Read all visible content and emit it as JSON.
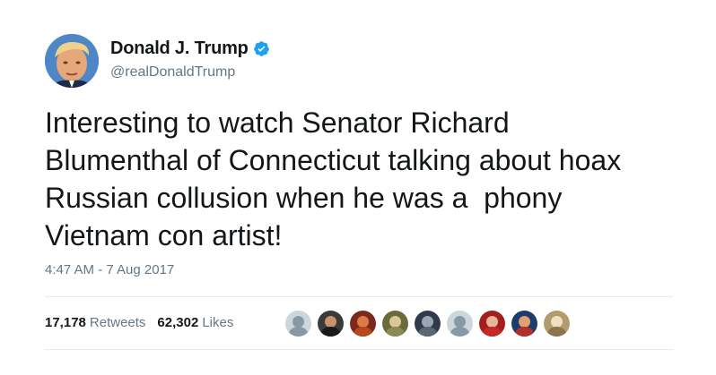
{
  "user": {
    "display_name": "Donald J. Trump",
    "handle": "@realDonaldTrump",
    "verified": true,
    "avatar_icon": "profile-photo"
  },
  "tweet": {
    "text": "Interesting to watch Senator Richard\nBlumenthal of Connecticut talking about hoax\nRussian collusion when he was a  phony\nVietnam con artist!",
    "timestamp": "4:47 AM - 7 Aug 2017"
  },
  "stats": {
    "retweets_count": "17,178",
    "retweets_label": "Retweets",
    "likes_count": "62,302",
    "likes_label": "Likes"
  },
  "liker_avatars": [
    {
      "bg": "#ccd6dd",
      "head": "#8899a6",
      "body": "#8899a6"
    },
    {
      "bg": "#3a3a3a",
      "head": "#c8926b",
      "body": "#1a1a1a"
    },
    {
      "bg": "#7a2a1c",
      "head": "#e07a45",
      "body": "#b8461f"
    },
    {
      "bg": "#6b6b3a",
      "head": "#d9c89a",
      "body": "#8a8a55"
    },
    {
      "bg": "#2f3b4a",
      "head": "#9aa7b3",
      "body": "#5a6675"
    },
    {
      "bg": "#ccd6dd",
      "head": "#8899a6",
      "body": "#8899a6"
    },
    {
      "bg": "#a31f1f",
      "head": "#e8b49a",
      "body": "#c62828"
    },
    {
      "bg": "#1b3d6b",
      "head": "#e0a070",
      "body": "#b2302b"
    },
    {
      "bg": "#b59a6e",
      "head": "#efe0c4",
      "body": "#8c7450"
    }
  ],
  "colors": {
    "verified": "#1da1f2",
    "secondary_text": "#657786",
    "primary_text": "#14171a",
    "divider": "#e6ecf0"
  }
}
